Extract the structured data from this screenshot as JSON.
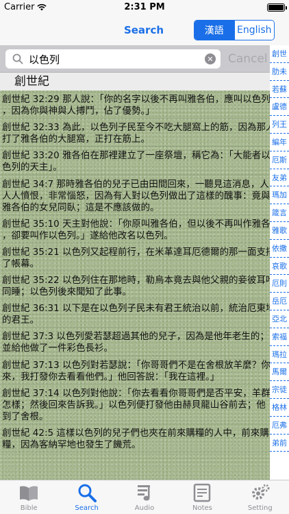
{
  "status": {
    "carrier": "Carrier",
    "time": "2:31 PM"
  },
  "nav": {
    "title": "Search",
    "seg_chinese": "漢語",
    "seg_english": "English"
  },
  "search": {
    "value": "以色列",
    "cancel": "Cancel"
  },
  "section": {
    "title": "創世紀"
  },
  "results": [
    {
      "line1": "創世紀 32:29 那人說：「你的名字以後不再叫雅各伯，應叫以色列",
      "line2": "，因為你與神與人搏鬥，佔了優勢。」"
    },
    {
      "line1": "創世紀 32:33 為此，以色列子民至今不吃大腿窩上的筋，因為那人",
      "line2": "打了雅各伯的大腿窩，正打在筋上。"
    },
    {
      "line1": "創世紀 33:20 雅各伯在那裡建立了一座祭壇，稱它為：「大能者以",
      "line2": "色列的天主」。"
    },
    {
      "line1": "創世紀 34:7 那時雅各伯的兒子已由田間回來，一聽見這消息，人",
      "line2": "人人憤恨，非常惱怒，因為有人對以色列做出了這樣的醜事：竟與",
      "line3": "雅各伯的女兒同臥；這是不應該做的。"
    },
    {
      "line1": "創世紀 35:10 天主對他說：「你原叫雅各伯，但以後不再叫作雅各伯",
      "line2": "，卻要叫作以色列。」遂給他改名以色列。"
    },
    {
      "line1": "創世紀 35:21 以色列又起程前行，在米革達耳厄德爾的那一面支搭",
      "line2": "了帳幕。"
    },
    {
      "line1": "創世紀 35:22 以色列住在那地時，勒烏本竟去與他父親的妾彼耳哈",
      "line2": "同睡；以色列後來聞知了此事。"
    },
    {
      "line1": "創世紀 36:31 以下是在以色列子民未有君王統治以前，統治厄東地",
      "line2": "的君王。"
    },
    {
      "line1": "創世紀 37:3 以色列愛若瑟超過其他的兒子，因為是他年老生的；",
      "line2": "並給他做了一件彩色長衫。"
    },
    {
      "line1": "創世紀 37:13 以色列對若瑟說：「你哥哥們不是在舍根放羊麼？你",
      "line2": "來，我打發你去看看他們。」他回答說：「我在這裡。」"
    },
    {
      "line1": "創世紀 37:14 以色列對他說：「你去看看你哥哥們是否平安，羊群",
      "line2": "怎樣；然後回來告訴我。」以色列便打發他由赫貝龍山谷前去；他",
      "line3": "到了舍根。"
    },
    {
      "line1": "創世紀 42:5 這樣以色列的兒子們也夾在前來購糧的人中，前來購",
      "line2": "糧，因為客納罕地也發生了饑荒。"
    }
  ],
  "index": [
    "創世",
    "肋未",
    "若蘇",
    "盧德",
    "列王",
    "編年",
    "厄斯",
    "友弟",
    "瑪加",
    "箴言",
    "雅歌",
    "依撒",
    "哀歌",
    "厄則",
    "岳厄",
    "亞北",
    "索福",
    "瑪拉",
    "馬爾",
    "宗徒",
    "格林",
    "厄弗",
    "弟前"
  ],
  "tabs": [
    {
      "label": "Bible",
      "icon": "book-icon"
    },
    {
      "label": "Search",
      "icon": "search-icon"
    },
    {
      "label": "Audio",
      "icon": "music-note-icon"
    },
    {
      "label": "Notes",
      "icon": "notes-icon"
    },
    {
      "label": "Setting",
      "icon": "gear-icon"
    }
  ],
  "colors": {
    "accent": "#1a6fe8",
    "inactive": "#8e8e93",
    "results_bg": "#a7b88f"
  }
}
